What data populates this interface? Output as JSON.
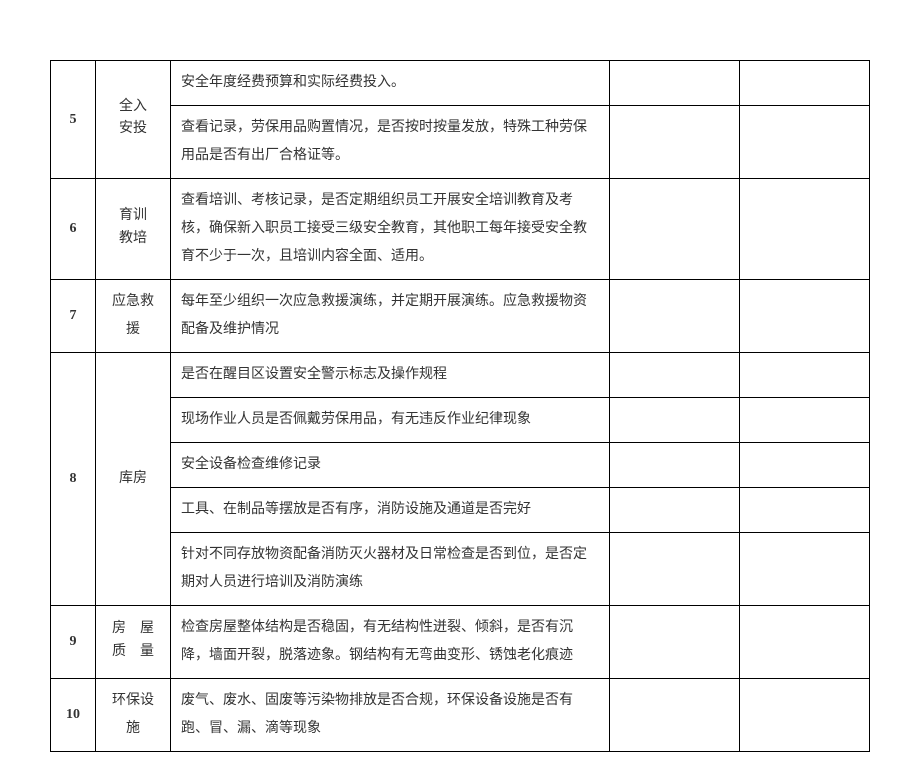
{
  "rows": [
    {
      "num": "5",
      "cat_lines": [
        "全入",
        "安投"
      ],
      "items": [
        "安全年度经费预算和实际经费投入。",
        "查看记录，劳保用品购置情况，是否按时按量发放，特殊工种劳保用品是否有出厂合格证等。"
      ]
    },
    {
      "num": "6",
      "cat_lines": [
        "育训",
        "教培"
      ],
      "items": [
        "查看培训、考核记录，是否定期组织员工开展安全培训教育及考核，确保新入职员工接受三级安全教育，其他职工每年接受安全教育不少于一次，且培训内容全面、适用。"
      ]
    },
    {
      "num": "7",
      "cat_plain": "应急救援",
      "items": [
        "每年至少组织一次应急救援演练，并定期开展演练。应急救援物资配备及维护情况"
      ]
    },
    {
      "num": "8",
      "cat_plain": "库房",
      "items": [
        "是否在醒目区设置安全警示标志及操作规程",
        "现场作业人员是否佩戴劳保用品，有无违反作业纪律现象",
        "安全设备检查维修记录",
        "工具、在制品等摆放是否有序，消防设施及通道是否完好",
        "针对不同存放物资配备消防灭火器材及日常检查是否到位，是否定期对人员进行培训及消防演练"
      ]
    },
    {
      "num": "9",
      "cat_lines": [
        "房　屋",
        "质　量"
      ],
      "items": [
        "检查房屋整体结构是否稳固，有无结构性迸裂、倾斜，是否有沉降，墙面开裂，脱落迹象。钢结构有无弯曲变形、锈蚀老化痕迹"
      ]
    },
    {
      "num": "10",
      "cat_plain": "环保设施",
      "items": [
        "废气、废水、固废等污染物排放是否合规，环保设备设施是否有跑、冒、漏、滴等现象"
      ]
    }
  ]
}
